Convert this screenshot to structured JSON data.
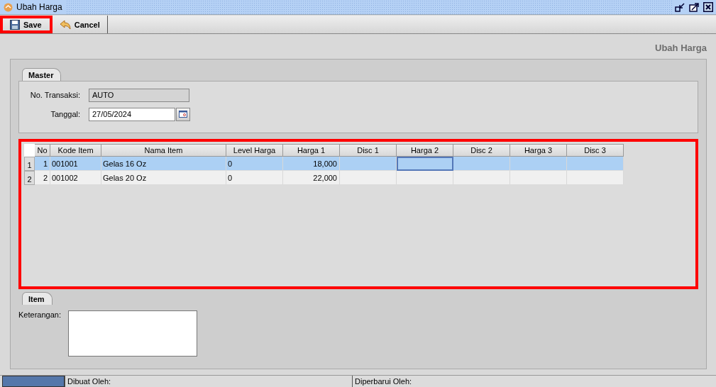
{
  "window": {
    "title": "Ubah Harga"
  },
  "toolbar": [
    {
      "label": "Save",
      "kind": "save",
      "highlighted": true
    },
    {
      "label": "Cancel",
      "kind": "cancel",
      "highlighted": false
    }
  ],
  "heading": "Ubah Harga",
  "master_tab": {
    "label": "Master"
  },
  "fields": [
    {
      "label": "No. Transaksi:",
      "value": "AUTO",
      "kind": "readonly"
    },
    {
      "label": "Tanggal:",
      "value": "27/05/2024",
      "kind": "date"
    }
  ],
  "table": {
    "highlighted": true,
    "columns": [
      "No",
      "Kode Item",
      "Nama Item",
      "Level Harga",
      "Harga 1",
      "Disc 1",
      "Harga 2",
      "Disc 2",
      "Harga 3",
      "Disc 3"
    ],
    "rows": [
      {
        "row_header": "1",
        "selected": true,
        "cells": [
          {
            "text": "1",
            "focused": false
          },
          {
            "text": "001001",
            "focused": false
          },
          {
            "text": "Gelas 16 Oz",
            "focused": false
          },
          {
            "text": "0",
            "focused": false
          },
          {
            "text": "18,000",
            "focused": false
          },
          {
            "text": "",
            "focused": false
          },
          {
            "text": "",
            "focused": true
          },
          {
            "text": "",
            "focused": false
          },
          {
            "text": "",
            "focused": false
          },
          {
            "text": "",
            "focused": false
          }
        ]
      },
      {
        "row_header": "2",
        "selected": false,
        "cells": [
          {
            "text": "2",
            "focused": false
          },
          {
            "text": "001002",
            "focused": false
          },
          {
            "text": "Gelas 20 Oz",
            "focused": false
          },
          {
            "text": "0",
            "focused": false
          },
          {
            "text": "22,000",
            "focused": false
          },
          {
            "text": "",
            "focused": false
          },
          {
            "text": "",
            "focused": false
          },
          {
            "text": "",
            "focused": false
          },
          {
            "text": "",
            "focused": false
          },
          {
            "text": "",
            "focused": false
          }
        ]
      }
    ]
  },
  "item_tab": {
    "label": "Item"
  },
  "notes": {
    "label": "Keterangan:"
  },
  "status_bar": [
    "Dibuat Oleh:",
    "Diperbarui Oleh:"
  ]
}
